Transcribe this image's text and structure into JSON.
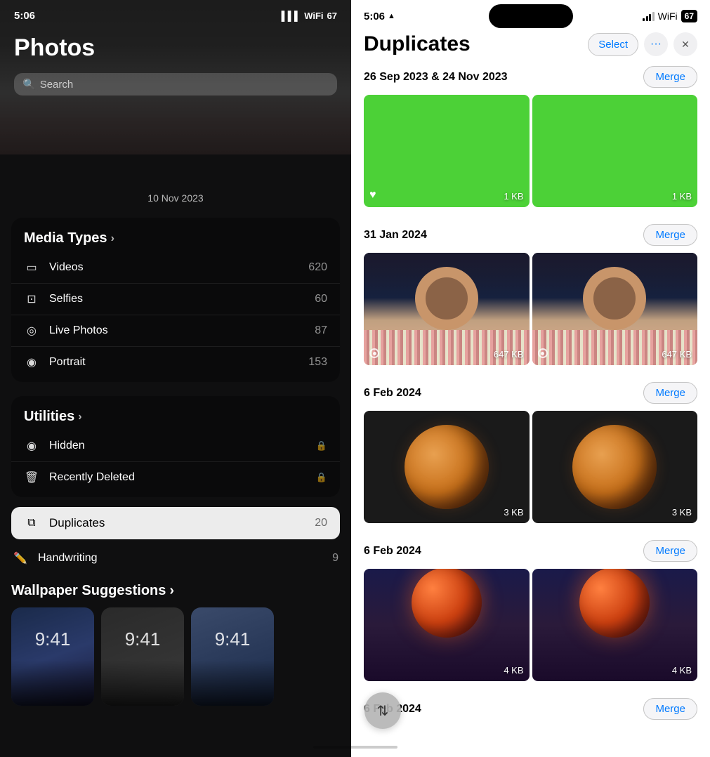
{
  "left": {
    "status_time": "5:06",
    "signal_text": "signal",
    "wifi_text": "wifi",
    "battery": "67",
    "photos_title": "Photos",
    "search_placeholder": "Search",
    "date_label": "10 Nov 2023",
    "media_types_title": "Media Types",
    "chevron": "›",
    "media_items": [
      {
        "icon": "▭",
        "label": "Videos",
        "count": "620"
      },
      {
        "icon": "⊡",
        "label": "Selfies",
        "count": "60"
      },
      {
        "icon": "◎",
        "label": "Live Photos",
        "count": "87"
      },
      {
        "icon": "◉",
        "label": "Portrait",
        "count": "153"
      }
    ],
    "utilities_title": "Utilities",
    "utilities_items": [
      {
        "icon": "◉",
        "label": "Hidden",
        "count": "🔒",
        "locked": true
      },
      {
        "icon": "🗑",
        "label": "Recently Deleted",
        "count": "🔒",
        "locked": true
      }
    ],
    "duplicates_label": "Duplicates",
    "duplicates_count": "20",
    "handwriting_label": "Handwriting",
    "handwriting_count": "9",
    "wallpaper_title": "Wallpaper Suggestions",
    "wallpaper_time": "9:41"
  },
  "right": {
    "status_time": "5:06",
    "page_title": "Duplicates",
    "select_label": "Select",
    "more_icon": "•••",
    "close_icon": "✕",
    "groups": [
      {
        "date": "26 Sep 2023 & 24 Nov 2023",
        "merge_label": "Merge",
        "photos": [
          {
            "type": "green",
            "size": "1 KB",
            "heart": true
          },
          {
            "type": "green",
            "size": "1 KB",
            "heart": false
          }
        ]
      },
      {
        "date": "31 Jan 2024",
        "merge_label": "Merge",
        "photos": [
          {
            "type": "selfie",
            "size": "647 KB",
            "live": true
          },
          {
            "type": "selfie",
            "size": "647 KB",
            "live": true
          }
        ]
      },
      {
        "date": "6 Feb 2024",
        "merge_label": "Merge",
        "photos": [
          {
            "type": "mars",
            "size": "3 KB"
          },
          {
            "type": "mars",
            "size": "3 KB"
          }
        ]
      },
      {
        "date": "6 Feb 2024",
        "merge_label": "Merge",
        "photos": [
          {
            "type": "redplanet",
            "size": "4 KB"
          },
          {
            "type": "redplanet",
            "size": "4 KB"
          }
        ]
      },
      {
        "date": "6 Feb 2024",
        "merge_label": "Merge",
        "photos": []
      }
    ],
    "fab_icon": "⇅"
  }
}
